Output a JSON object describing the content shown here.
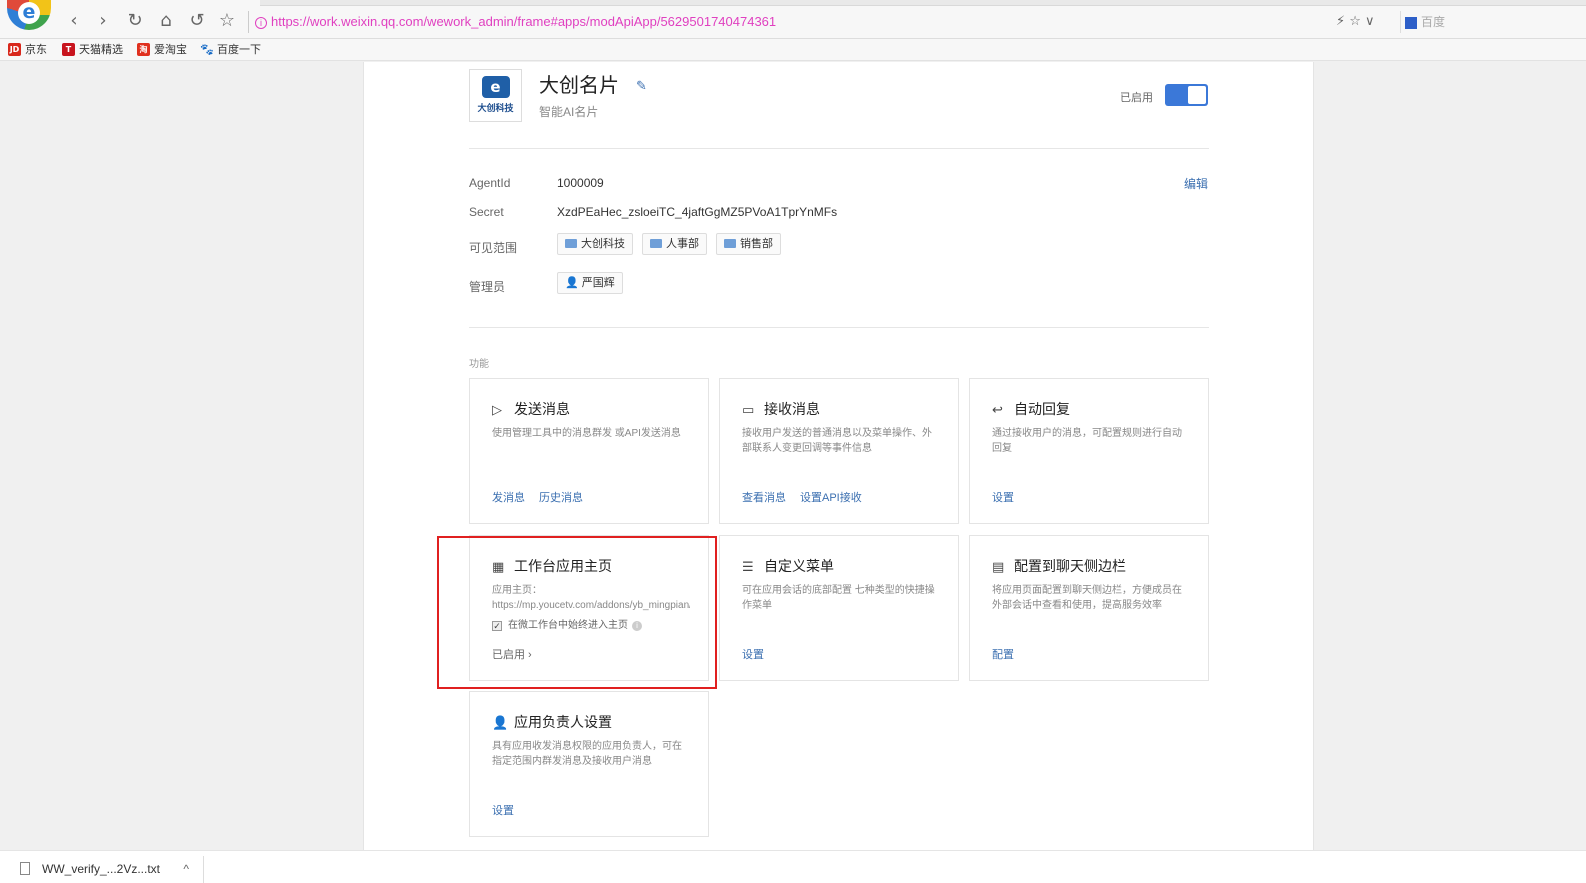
{
  "browser": {
    "logo_letter": "e",
    "url": "https://work.weixin.qq.com/wework_admin/frame#apps/modApiApp/5629501740474361",
    "url_info_glyph": "i",
    "tool_icons": "⚡ ☆ ∨",
    "search_engine": "百度",
    "bookmarks": [
      {
        "icon_text": "JD",
        "label": "京东",
        "color": "#d8281c"
      },
      {
        "icon_text": "T",
        "label": "天猫精选",
        "color": "#c8141e"
      },
      {
        "icon_text": "淘",
        "label": "爱淘宝",
        "color": "#e0301e"
      },
      {
        "icon_text": "🐾",
        "label": "百度一下",
        "color": "#2d5fc8"
      }
    ]
  },
  "app": {
    "logo_mark": "e",
    "logo_text": "大创科技",
    "name": "大创名片",
    "subtitle": "智能AI名片",
    "enabled_label": "已启用",
    "enabled": true
  },
  "fields": {
    "agentid_label": "AgentId",
    "agentid_value": "1000009",
    "edit_label": "编辑",
    "secret_label": "Secret",
    "secret_value": "XzdPEaHec_zsloeiTC_4jaftGgMZ5PVoA1TprYnMFs",
    "visible_label": "可见范围",
    "visible_tags": [
      "大创科技",
      "人事部",
      "销售部"
    ],
    "admin_label": "管理员",
    "admin_tag": "严国辉"
  },
  "section_label": "功能",
  "cards": [
    {
      "icon": "▷",
      "title": "发送消息",
      "desc": "使用管理工具中的消息群发 或API发送消息",
      "actions": [
        "发消息",
        "历史消息"
      ]
    },
    {
      "icon": "▭",
      "title": "接收消息",
      "desc": "接收用户发送的普通消息以及菜单操作、外部联系人变更回调等事件信息",
      "actions": [
        "查看消息",
        "设置API接收"
      ]
    },
    {
      "icon": "↩",
      "title": "自动回复",
      "desc": "通过接收用户的消息，可配置规则进行自动回复",
      "actions": [
        "设置"
      ]
    },
    {
      "icon": "▦",
      "title": "工作台应用主页",
      "desc": "应用主页：https://mp.youcetv.com/addons/yb_mingpian/core/web.php?mch_id=...",
      "check_label": "在微工作台中始终进入主页",
      "status": "已启用 ›"
    },
    {
      "icon": "☰",
      "title": "自定义菜单",
      "desc": "可在应用会话的底部配置 七种类型的快捷操作菜单",
      "actions": [
        "设置"
      ]
    },
    {
      "icon": "▤",
      "title": "配置到聊天侧边栏",
      "desc": "将应用页面配置到聊天侧边栏，方便成员在外部会话中查看和使用，提高服务效率",
      "actions": [
        "配置"
      ]
    },
    {
      "icon": "👤",
      "title": "应用负责人设置",
      "desc": "具有应用收发消息权限的应用负责人，可在指定范围内群发消息及接收用户消息",
      "actions": [
        "设置"
      ]
    }
  ],
  "download": {
    "filename": "WW_verify_...2Vz...txt",
    "chevron": "^"
  }
}
